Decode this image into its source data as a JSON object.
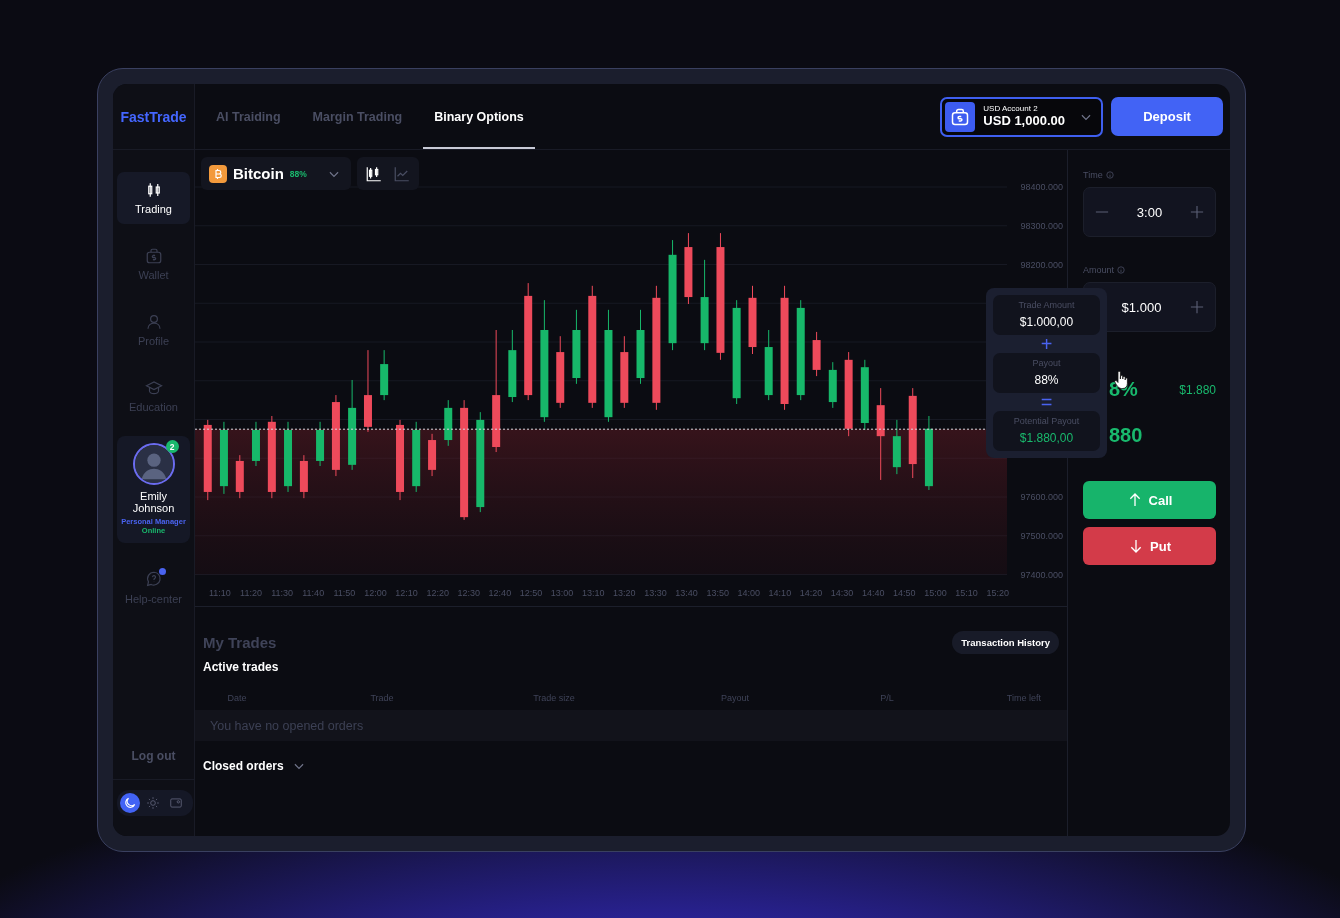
{
  "brand": "FastTrade",
  "tabs": [
    {
      "label": "AI Traiding",
      "selected": false
    },
    {
      "label": "Margin Trading",
      "selected": false
    },
    {
      "label": "Binary Options",
      "selected": true
    }
  ],
  "account": {
    "label": "USD Account 2",
    "balance": "USD 1,000.00"
  },
  "deposit_button": "Deposit",
  "sidebar": {
    "items": [
      {
        "label": "Trading",
        "selected": true
      },
      {
        "label": "Wallet",
        "selected": false
      },
      {
        "label": "Profile",
        "selected": false
      },
      {
        "label": "Education",
        "selected": false
      }
    ],
    "manager": {
      "name": "Emily Johnson",
      "role": "Personal Manager",
      "status": "Online",
      "badge": "2"
    },
    "help": {
      "label": "Help-center",
      "notification": true
    },
    "logout": "Log out",
    "theme": [
      {
        "selected": true
      },
      {
        "selected": false
      },
      {
        "selected": false
      }
    ]
  },
  "asset": {
    "name": "Bitcoin",
    "payout": "88%"
  },
  "chart_types": [
    {
      "selected": true
    },
    {
      "selected": false
    }
  ],
  "chart_data": {
    "type": "candlestick",
    "ylim": [
      97400,
      98400
    ],
    "xlim": [
      662,
      923
    ],
    "grid": true,
    "ref_lines": [
      {
        "axis": "y",
        "value": 97775
      }
    ],
    "x": [
      666.1,
      671.3,
      676.4,
      681.6,
      686.7,
      691.9,
      697.0,
      702.2,
      707.3,
      712.5,
      717.6,
      722.8,
      727.9,
      733.1,
      738.2,
      743.4,
      748.5,
      753.7,
      758.8,
      764.0,
      769.1,
      774.3,
      779.4,
      784.6,
      789.7,
      794.9,
      800.0,
      805.2,
      810.3,
      815.5,
      820.6,
      825.8,
      830.9,
      836.1,
      841.2,
      846.4,
      851.5,
      856.7,
      861.8,
      867.0,
      872.1,
      877.3,
      882.4,
      887.6,
      892.7,
      897.9
    ],
    "yticks": [
      {
        "value": 98400,
        "label": "98400.000"
      },
      {
        "value": 98300,
        "label": "98300.000"
      },
      {
        "value": 98200,
        "label": "98200.000"
      },
      {
        "value": 97600,
        "label": "97600.000"
      },
      {
        "value": 97500,
        "label": "97500.000"
      },
      {
        "value": 97400,
        "label": "97400.000"
      }
    ],
    "xticks": [
      {
        "value": 670,
        "label": "11:10"
      },
      {
        "value": 680,
        "label": "11:20"
      },
      {
        "value": 690,
        "label": "11:30"
      },
      {
        "value": 700,
        "label": "11:40"
      },
      {
        "value": 710,
        "label": "11:50"
      },
      {
        "value": 720,
        "label": "12:00"
      },
      {
        "value": 730,
        "label": "12:10"
      },
      {
        "value": 740,
        "label": "12:20"
      },
      {
        "value": 750,
        "label": "12:30"
      },
      {
        "value": 760,
        "label": "12:40"
      },
      {
        "value": 770,
        "label": "12:50"
      },
      {
        "value": 780,
        "label": "13:00"
      },
      {
        "value": 790,
        "label": "13:10"
      },
      {
        "value": 800,
        "label": "13:20"
      },
      {
        "value": 810,
        "label": "13:30"
      },
      {
        "value": 820,
        "label": "13:40"
      },
      {
        "value": 830,
        "label": "13:50"
      },
      {
        "value": 840,
        "label": "14:00"
      },
      {
        "value": 850,
        "label": "14:10"
      },
      {
        "value": 860,
        "label": "14:20"
      },
      {
        "value": 870,
        "label": "14:30"
      },
      {
        "value": 880,
        "label": "14:40"
      },
      {
        "value": 890,
        "label": "14:50"
      },
      {
        "value": 900,
        "label": "15:00"
      },
      {
        "value": 910,
        "label": "15:10"
      },
      {
        "value": 920,
        "label": "15:20"
      }
    ],
    "ohlc": [
      [
        97786,
        97799,
        97592,
        97613
      ],
      [
        97628,
        97794,
        97608,
        97773
      ],
      [
        97693,
        97708,
        97597,
        97613
      ],
      [
        97693,
        97794,
        97680,
        97773
      ],
      [
        97794,
        97809,
        97597,
        97613
      ],
      [
        97628,
        97794,
        97613,
        97773
      ],
      [
        97693,
        97708,
        97597,
        97613
      ],
      [
        97693,
        97794,
        97680,
        97773
      ],
      [
        97845,
        97863,
        97654,
        97670
      ],
      [
        97683,
        97902,
        97670,
        97830
      ],
      [
        97863,
        97979,
        97768,
        97781
      ],
      [
        97863,
        97979,
        97850,
        97943
      ],
      [
        97786,
        97799,
        97592,
        97613
      ],
      [
        97628,
        97794,
        97613,
        97773
      ],
      [
        97747,
        97763,
        97654,
        97670
      ],
      [
        97747,
        97850,
        97732,
        97830
      ],
      [
        97830,
        97850,
        97541,
        97548
      ],
      [
        97574,
        97819,
        97561,
        97799
      ],
      [
        97863,
        98031,
        97716,
        97729
      ],
      [
        97858,
        98031,
        97845,
        97979
      ],
      [
        98119,
        98152,
        97850,
        97863
      ],
      [
        97806,
        98108,
        97794,
        98031
      ],
      [
        97974,
        98015,
        97830,
        97843
      ],
      [
        97907,
        98083,
        97892,
        98031
      ],
      [
        98119,
        98145,
        97830,
        97843
      ],
      [
        97806,
        98083,
        97794,
        98031
      ],
      [
        97974,
        98015,
        97830,
        97843
      ],
      [
        97907,
        98083,
        97892,
        98031
      ],
      [
        98114,
        98145,
        97825,
        97843
      ],
      [
        97997,
        98263,
        97979,
        98225
      ],
      [
        98245,
        98281,
        98098,
        98116
      ],
      [
        97997,
        98212,
        97979,
        98116
      ],
      [
        98245,
        98281,
        97954,
        97972
      ],
      [
        97855,
        98108,
        97840,
        98088
      ],
      [
        98114,
        98145,
        97969,
        97987
      ],
      [
        97863,
        98031,
        97850,
        97987
      ],
      [
        98114,
        98145,
        97825,
        97840
      ],
      [
        97863,
        98108,
        97850,
        98088
      ],
      [
        98005,
        98026,
        97912,
        97928
      ],
      [
        97845,
        97948,
        97830,
        97928
      ],
      [
        97954,
        97974,
        97757,
        97776
      ],
      [
        97791,
        97954,
        97773,
        97935
      ],
      [
        97837,
        97881,
        97644,
        97757
      ],
      [
        97677,
        97799,
        97659,
        97757
      ],
      [
        97861,
        97881,
        97649,
        97685
      ],
      [
        97628,
        97809,
        97618,
        97776
      ]
    ]
  },
  "trades": {
    "title": "My Trades",
    "history_button": "Transaction History",
    "active_title": "Active trades",
    "columns": [
      "Date",
      "Trade",
      "Trade size",
      "Payout",
      "P/L",
      "Time left"
    ],
    "empty": "You have no opened orders",
    "closed_title": "Closed orders"
  },
  "order": {
    "time_label": "Time",
    "time": "3:00",
    "amount_label": "Amount",
    "amount": "$1.000",
    "payout_percent": "8%",
    "payout_amount": "$1.880",
    "profit": "880",
    "call": "Call",
    "put": "Put"
  },
  "tooltip": {
    "items": [
      {
        "label": "Trade Amount",
        "value": "$1.000,00",
        "kind": "term"
      },
      {
        "label": "Payout",
        "value": "88%",
        "kind": "term"
      },
      {
        "label": "Potential Payout",
        "value": "$1.880,00",
        "kind": "total"
      }
    ],
    "operators": [
      "+",
      "="
    ]
  }
}
